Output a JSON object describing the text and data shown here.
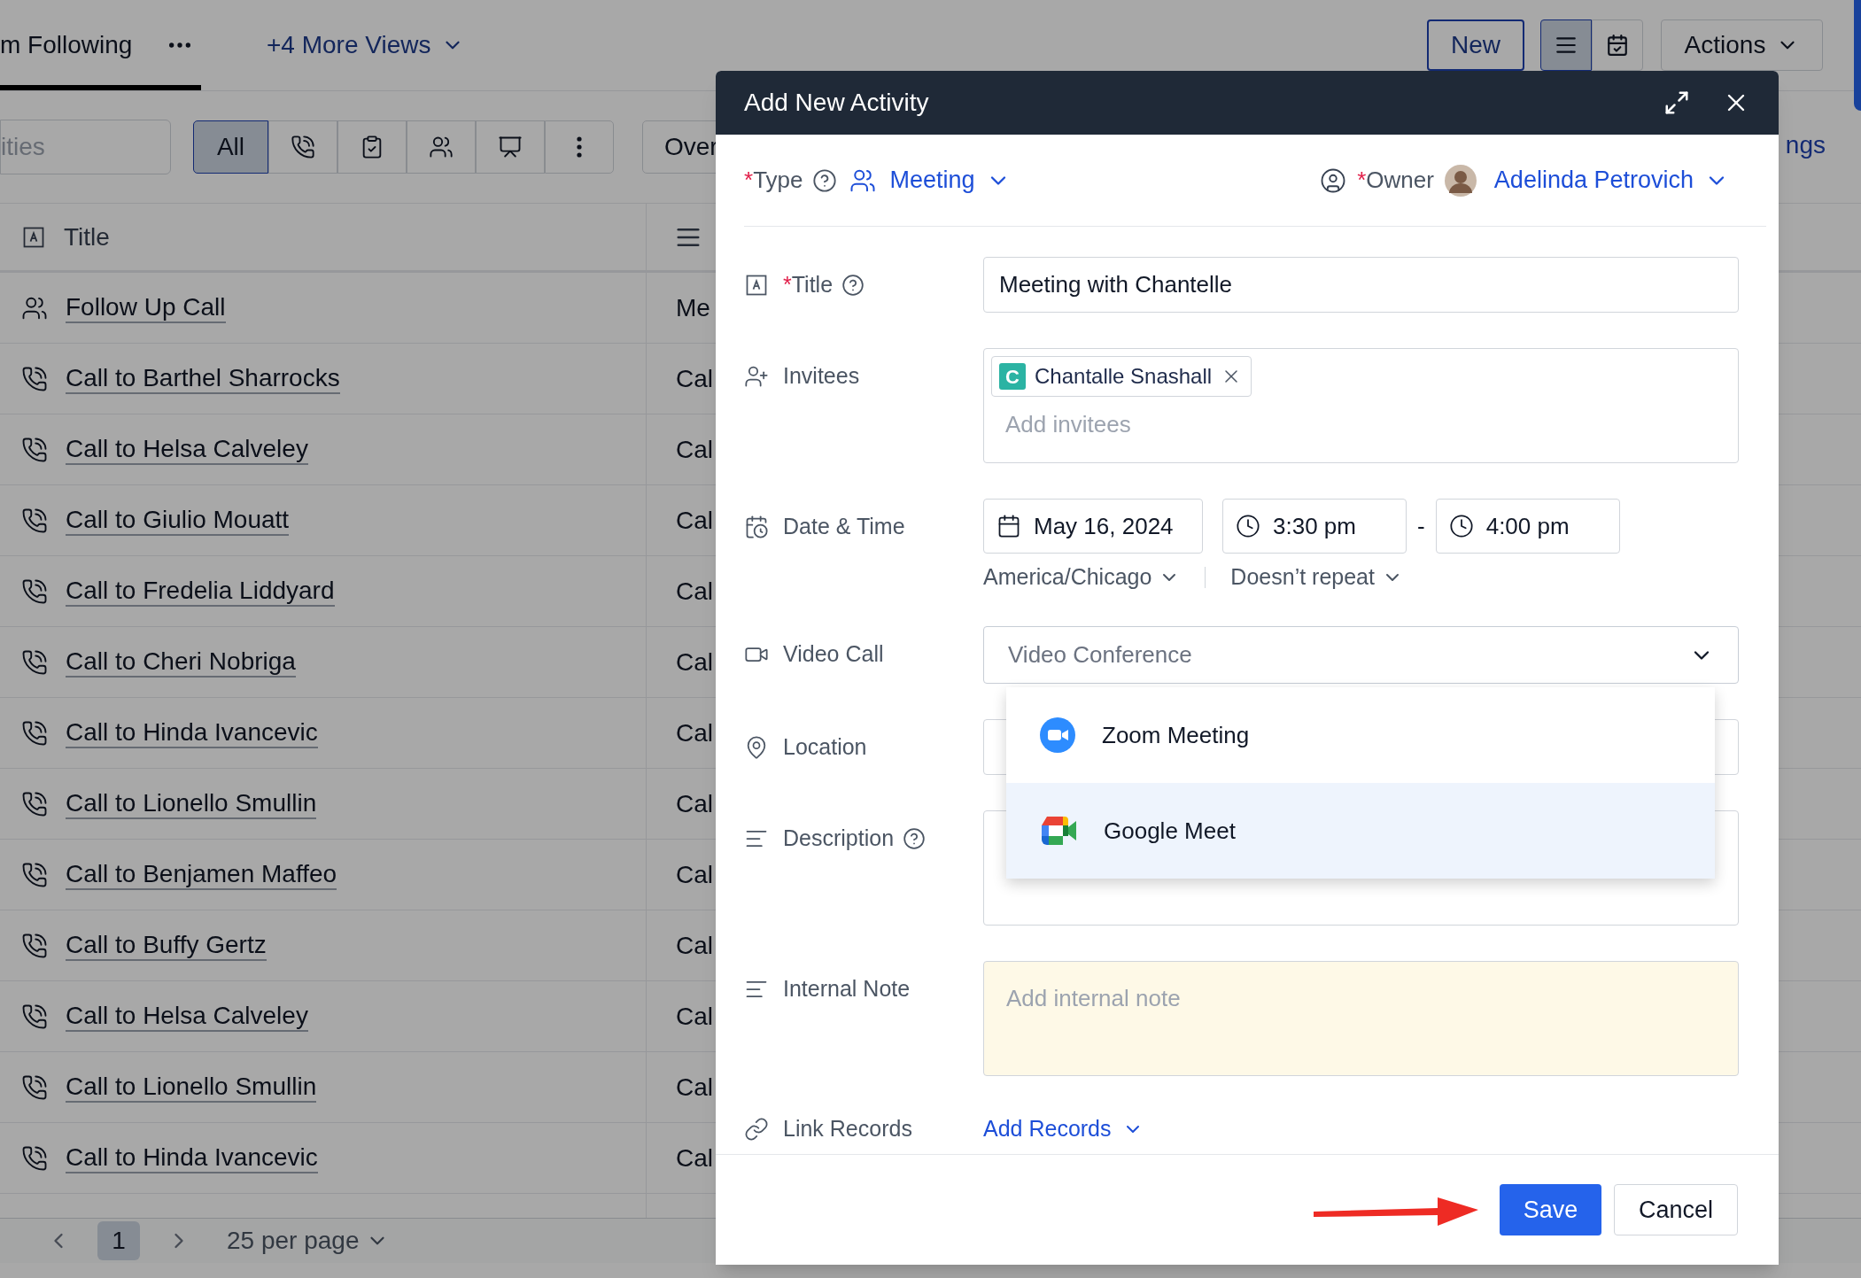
{
  "page": {
    "view_tab": {
      "label": "m Following",
      "selected": true
    },
    "more_views": "+4 More Views",
    "new_button": "New",
    "view_toggles": [
      {
        "kind": "list",
        "selected": true
      },
      {
        "kind": "calendar",
        "selected": false
      }
    ],
    "actions_button": "Actions",
    "search": {
      "placeholder": "ities"
    },
    "filters": [
      {
        "kind": "all",
        "label": "All",
        "selected": true
      },
      {
        "kind": "call",
        "selected": false
      },
      {
        "kind": "task",
        "selected": false
      },
      {
        "kind": "meeting",
        "selected": false
      },
      {
        "kind": "presentation",
        "selected": false
      },
      {
        "kind": "more",
        "selected": false
      }
    ],
    "overview_button": "Over",
    "settings_link": "ngs",
    "table": {
      "columns": [
        {
          "label": "Title"
        }
      ],
      "rows": [
        {
          "kind": "meeting",
          "title": "Follow Up Call",
          "column_2": "Me"
        },
        {
          "kind": "call",
          "title": "Call to Barthel Sharrocks",
          "column_2": "Cal"
        },
        {
          "kind": "call",
          "title": "Call to Helsa Calveley",
          "column_2": "Cal"
        },
        {
          "kind": "call",
          "title": "Call to Giulio Mouatt",
          "column_2": "Cal"
        },
        {
          "kind": "call",
          "title": "Call to Fredelia Liddyard",
          "column_2": "Cal"
        },
        {
          "kind": "call",
          "title": "Call to Cheri Nobriga",
          "column_2": "Cal"
        },
        {
          "kind": "call",
          "title": "Call to Hinda Ivancevic",
          "column_2": "Cal"
        },
        {
          "kind": "call",
          "title": "Call to Lionello Smullin",
          "column_2": "Cal"
        },
        {
          "kind": "call",
          "title": "Call to Benjamen Maffeo",
          "column_2": "Cal"
        },
        {
          "kind": "call",
          "title": "Call to Buffy Gertz",
          "column_2": "Cal"
        },
        {
          "kind": "call",
          "title": "Call to Helsa Calveley",
          "column_2": "Cal"
        },
        {
          "kind": "call",
          "title": "Call to Lionello Smullin",
          "column_2": "Cal"
        },
        {
          "kind": "call",
          "title": "Call to Hinda Ivancevic",
          "column_2": "Cal"
        }
      ]
    },
    "pagination": {
      "pages": [
        {
          "label": "1",
          "selected": true
        }
      ],
      "per_page": "25 per page"
    }
  },
  "modal": {
    "title": "Add New Activity",
    "type": {
      "required_mark": "*",
      "label": "Type",
      "value": "Meeting"
    },
    "owner": {
      "required_mark": "*",
      "label": "Owner",
      "value": "Adelinda Petrovich"
    },
    "fields": [
      {
        "kind": "text",
        "label": "Title",
        "required_mark": "*",
        "help": true,
        "value": "Meeting with Chantelle"
      },
      {
        "kind": "invitees",
        "label": "Invitees",
        "chips": [
          {
            "initial": "C",
            "name": "Chantalle Snashall",
            "color": "#2bb3a3"
          }
        ],
        "placeholder": "Add invitees"
      },
      {
        "kind": "datetime",
        "label": "Date & Time",
        "date": "May 16, 2024",
        "start": "3:30 pm",
        "separator": "-",
        "end": "4:00 pm",
        "timezone": "America/Chicago",
        "repeat": "Doesn’t repeat"
      },
      {
        "kind": "select",
        "label": "Video Call",
        "placeholder": "Video Conference",
        "expanded": true,
        "options": [
          {
            "kind": "zoom",
            "label": "Zoom Meeting",
            "selected": false
          },
          {
            "kind": "meet",
            "label": "Google Meet",
            "selected": true
          }
        ]
      },
      {
        "kind": "location",
        "label": "Location"
      },
      {
        "kind": "textarea",
        "label": "Description",
        "help": true
      },
      {
        "kind": "note",
        "label": "Internal Note",
        "placeholder": "Add internal note"
      },
      {
        "kind": "links",
        "label": "Link Records",
        "action": "Add Records"
      }
    ],
    "buttons": [
      {
        "kind": "primary",
        "label": "Save"
      },
      {
        "kind": "secondary",
        "label": "Cancel"
      }
    ]
  }
}
